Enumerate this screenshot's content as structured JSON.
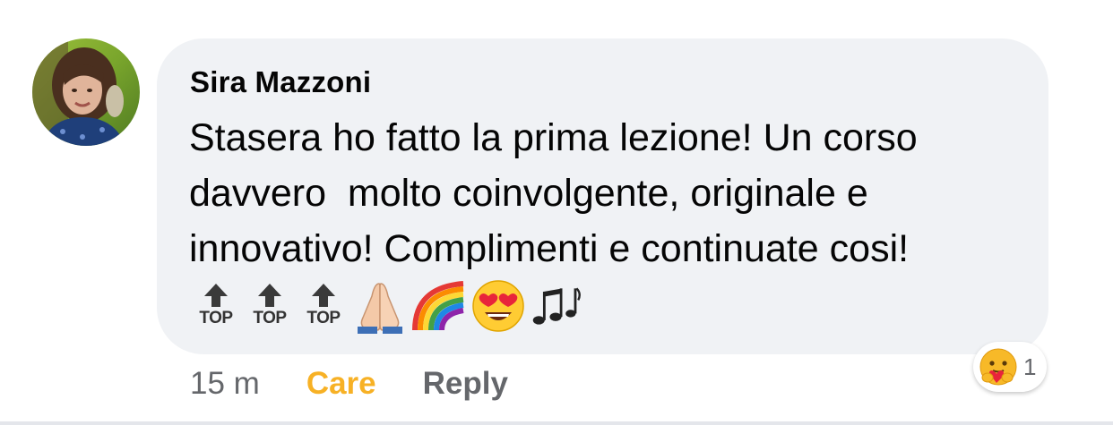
{
  "comment": {
    "author": "Sira Mazzoni",
    "text": "Stasera ho fatto la prima lezione! Un corso\ndavvero  molto coinvolgente, originale e\ninnovativo! Complimenti e continuate cosi!",
    "emojis": {
      "top_label": "TOP",
      "sequence": [
        "top-arrow",
        "top-arrow",
        "top-arrow",
        "folded-hands",
        "rainbow",
        "heart-eyes",
        "musical-notes"
      ]
    },
    "timestamp": "15 m",
    "reaction_label": "Care",
    "reply_label": "Reply",
    "reaction_summary": {
      "icon": "care-hug-face",
      "count": "1"
    }
  },
  "colors": {
    "bubble_bg": "#f0f2f5",
    "care": "#f7b125",
    "secondary_text": "#65676b",
    "primary_text": "#050505"
  }
}
